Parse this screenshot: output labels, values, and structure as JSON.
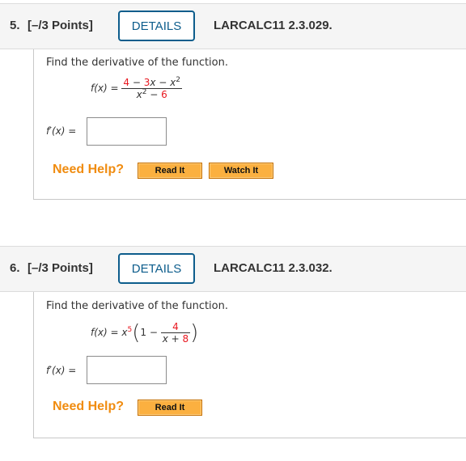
{
  "questions": [
    {
      "number": "5.",
      "points": "[–/3 Points]",
      "details_label": "DETAILS",
      "code": "LARCALC11 2.3.029.",
      "prompt": "Find the derivative of the function.",
      "function": {
        "lhs": "f(x) =",
        "numerator": {
          "c1": "4",
          "op1": " − ",
          "c2": "3",
          "var1": "x",
          "op2": " − ",
          "var2": "x",
          "exp": "2"
        },
        "denominator": {
          "var": "x",
          "exp": "2",
          "op": " − ",
          "c": "6"
        }
      },
      "answer_label": "f′(x) =",
      "answer_value": "",
      "need_help": "Need Help?",
      "help_buttons": [
        "Read It",
        "Watch It"
      ]
    },
    {
      "number": "6.",
      "points": "[–/3 Points]",
      "details_label": "DETAILS",
      "code": "LARCALC11 2.3.032.",
      "prompt": "Find the derivative of the function.",
      "function": {
        "lhs": "f(x) =",
        "base": "x",
        "exp": "5",
        "one": "1",
        "minus": " − ",
        "numerator": "4",
        "den_var": "x",
        "den_op": " + ",
        "den_c": "8"
      },
      "answer_label": "f′(x) =",
      "answer_value": "",
      "need_help": "Need Help?",
      "help_buttons": [
        "Read It"
      ]
    }
  ],
  "colors": {
    "accent": "#0d5d8c",
    "randomized_value": "#e8171f",
    "help_text": "#f08c10",
    "help_button": "#fbb040"
  }
}
